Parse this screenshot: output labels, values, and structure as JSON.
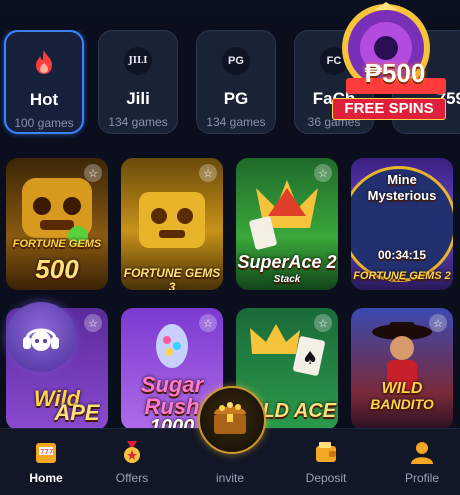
{
  "categories": [
    {
      "label": "Hot",
      "count": "100 games",
      "icon": "fire-icon"
    },
    {
      "label": "Jili",
      "count": "134 games",
      "icon": "JILI"
    },
    {
      "label": "PG",
      "count": "134 games",
      "icon": "PG"
    },
    {
      "label": "FaCh",
      "count": "36 games",
      "icon": "FC"
    },
    {
      "label": "759",
      "count": "",
      "icon": ""
    }
  ],
  "games": [
    {
      "name": "FORTUNE GEMS 500",
      "line1": "FORTUNE GEMS",
      "line2": "500"
    },
    {
      "name": "FORTUNE GEMS 3",
      "line1": "FORTUNE GEMS 3",
      "line2": ""
    },
    {
      "name": "SUPER ACE 2 Stack",
      "line1": "SuperAce 2",
      "line2": "Stack"
    },
    {
      "name": "Mine Mysterious Fortune Gems 2",
      "line1": "Mine",
      "line2": "Mysterious",
      "timer": "00:34:15",
      "line3": "FORTUNE GEMS 2"
    },
    {
      "name": "Wild Ape",
      "line1": "Wild",
      "line2": "APE"
    },
    {
      "name": "Sugar Rush 1000",
      "line1": "Sugar",
      "line2": "Rush",
      "line3": "1000"
    },
    {
      "name": "Wild Ace",
      "line1": "WILD ACE",
      "line2": ""
    },
    {
      "name": "Wild Bandito",
      "line1": "WILD",
      "line2": "BANDITO"
    }
  ],
  "promo": {
    "amount": "₱500",
    "label": "FREE SPINS"
  },
  "nav": [
    {
      "label": "Home",
      "icon": "slot-machine-icon"
    },
    {
      "label": "Offers",
      "icon": "medal-icon"
    },
    {
      "label": "invite",
      "icon": "treasure-chest-icon"
    },
    {
      "label": "Deposit",
      "icon": "wallet-icon"
    },
    {
      "label": "Profile",
      "icon": "profile-icon"
    }
  ],
  "colors": {
    "background": "#0a0e1d",
    "accent": "#3a82ff",
    "gold": "#f5c43a",
    "promo_red": "#e0203a"
  }
}
